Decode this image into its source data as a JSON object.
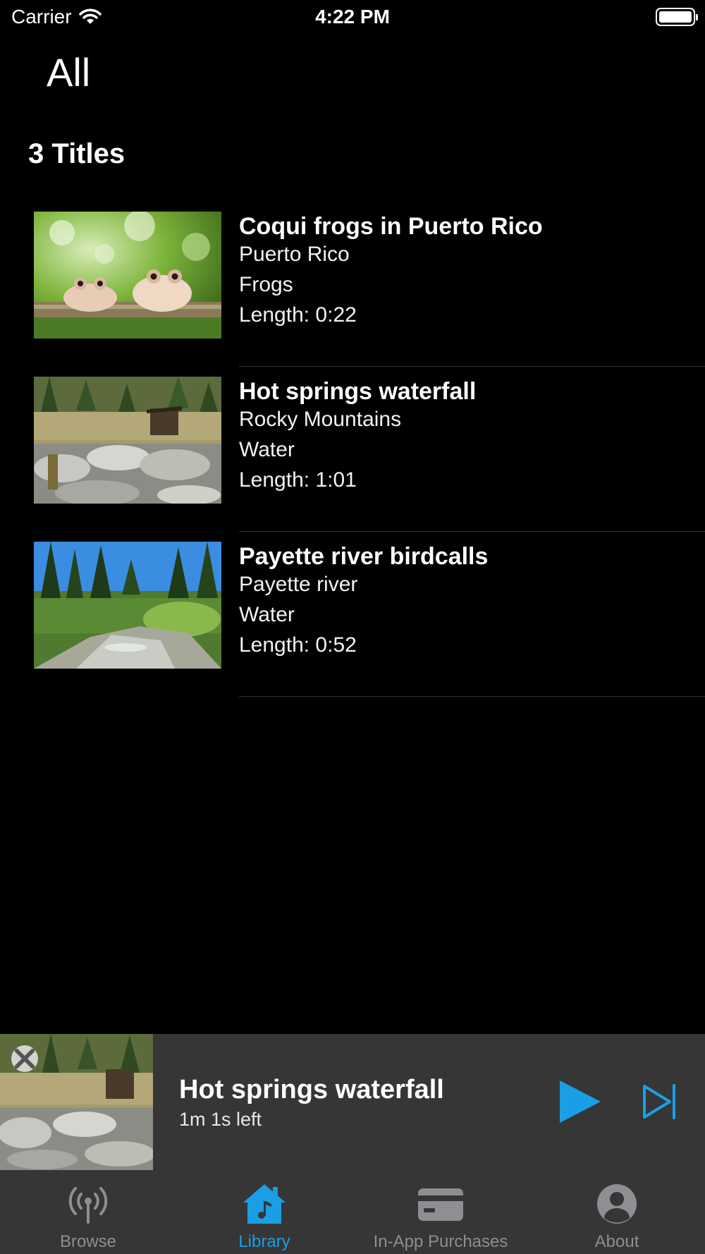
{
  "status_bar": {
    "carrier": "Carrier",
    "time": "4:22 PM"
  },
  "nav": {
    "title": "All"
  },
  "library": {
    "count_label": "3 Titles",
    "items": [
      {
        "title": "Coqui frogs in Puerto Rico",
        "location": "Puerto Rico",
        "category": "Frogs",
        "length": "Length:  0:22",
        "thumb": "frogs-thumbnail"
      },
      {
        "title": "Hot springs waterfall",
        "location": "Rocky Mountains",
        "category": "Water",
        "length": "Length:  1:01",
        "thumb": "hot-springs-thumbnail"
      },
      {
        "title": "Payette river birdcalls",
        "location": "Payette river",
        "category": "Water",
        "length": "Length:  0:52",
        "thumb": "river-thumbnail"
      }
    ]
  },
  "now_playing": {
    "title": "Hot springs waterfall",
    "remaining": "1m 1s  left",
    "thumb": "hot-springs-thumbnail",
    "controls": [
      "play-icon",
      "skip-forward-icon"
    ],
    "accent": "#1a9fe5"
  },
  "tab_bar": {
    "tabs": [
      {
        "label": "Browse",
        "icon": "antenna-icon",
        "active": false
      },
      {
        "label": "Library",
        "icon": "music-house-icon",
        "active": true
      },
      {
        "label": "In-App Purchases",
        "icon": "credit-card-icon",
        "active": false
      },
      {
        "label": "About",
        "icon": "person-circle-icon",
        "active": false
      }
    ]
  },
  "colors": {
    "background": "#000000",
    "panel": "#363636",
    "accent": "#1a9fe5",
    "inactive": "#8e8e93"
  }
}
